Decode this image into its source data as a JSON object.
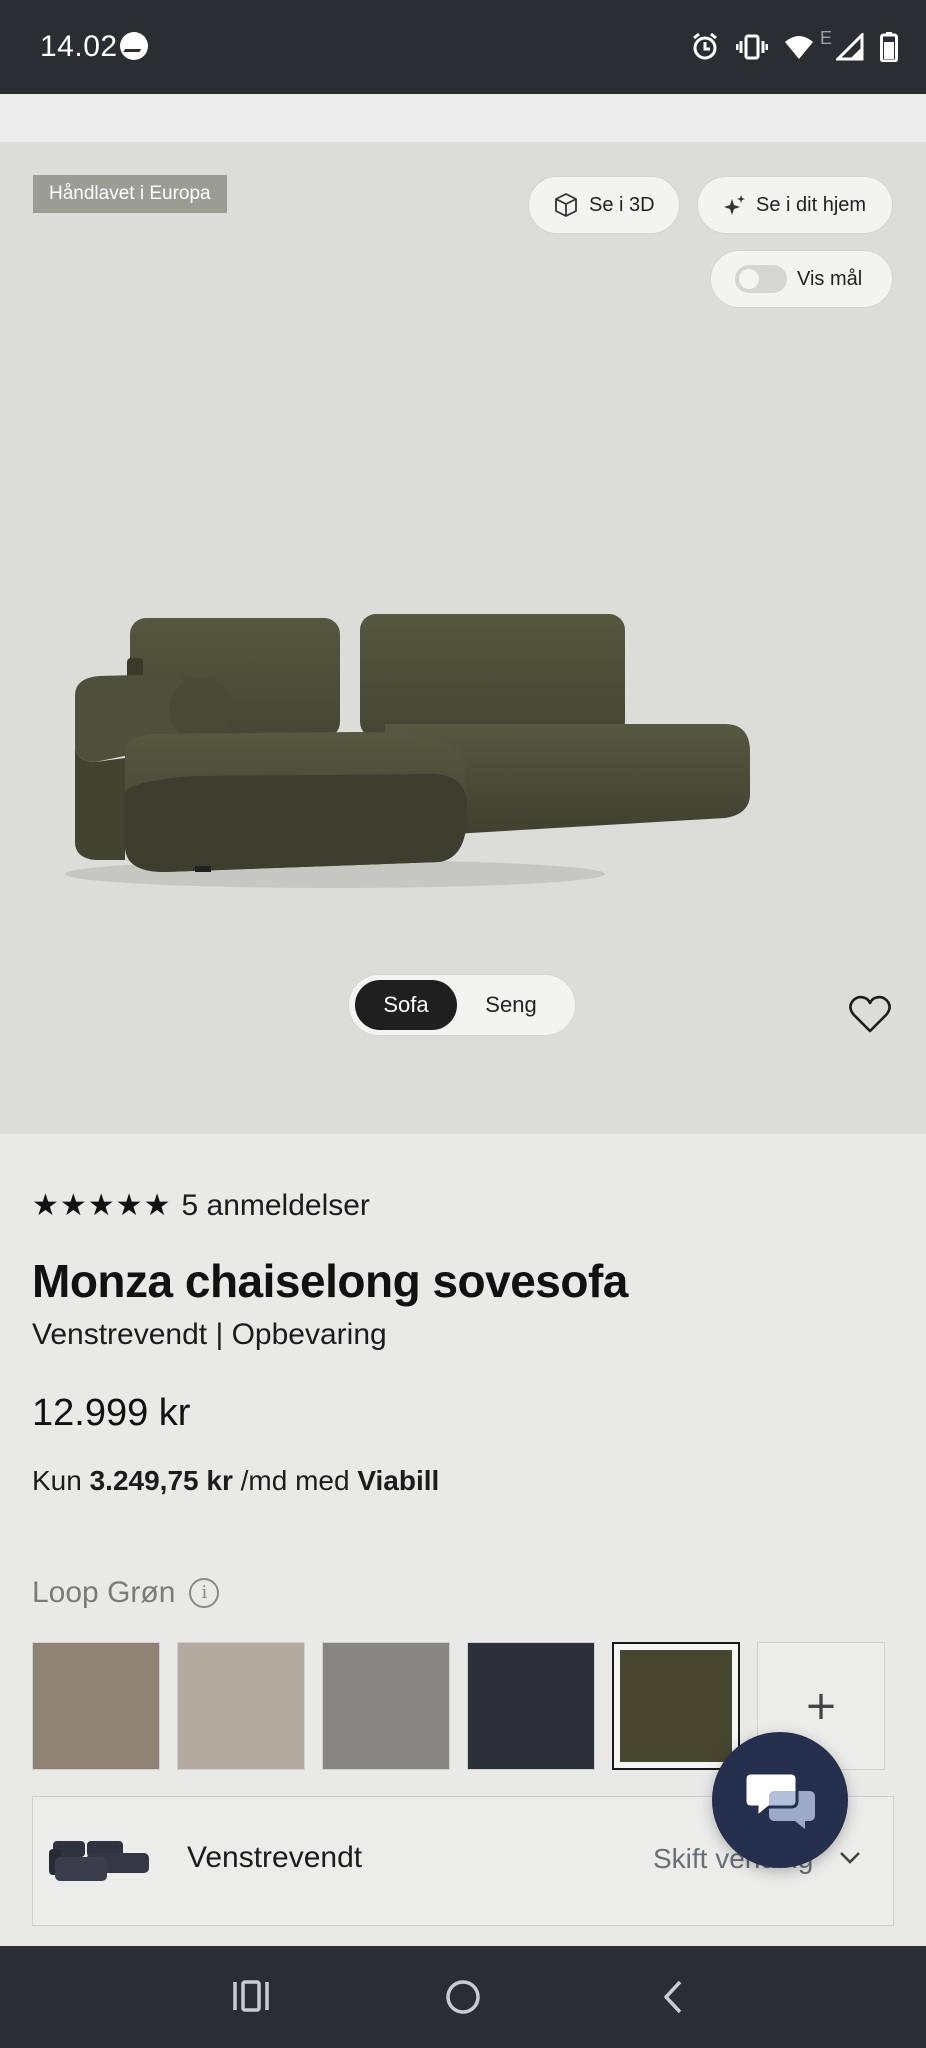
{
  "status_bar": {
    "time": "14.02",
    "network_label": "E"
  },
  "hero": {
    "badge": "Håndlavet i Europa",
    "view_3d": "Se i 3D",
    "view_home": "Se i dit hjem",
    "show_size": "Vis mål",
    "show_size_toggle_on": false,
    "segments": [
      "Sofa",
      "Seng"
    ],
    "active_segment": "Sofa"
  },
  "product": {
    "stars": "★★★★★",
    "rating_value": 5,
    "reviews": "5 anmeldelser",
    "title": "Monza chaiselong sovesofa",
    "subtitle": "Venstrevendt | Opbevaring",
    "price": "12.999 kr",
    "finance": {
      "prefix": "Kun",
      "amount": "3.249,75 kr",
      "middle": "/md med",
      "provider": "Viabill"
    }
  },
  "colors": {
    "selected_name": "Loop Grøn",
    "info_icon": "i",
    "more_label": "+",
    "swatches": [
      {
        "name": "swatch-taupe",
        "color": "#8e8275",
        "selected": false
      },
      {
        "name": "swatch-beige",
        "color": "#b3aba0",
        "selected": false
      },
      {
        "name": "swatch-grey",
        "color": "#878683",
        "selected": false
      },
      {
        "name": "swatch-navy",
        "color": "#2c3038",
        "selected": false
      },
      {
        "name": "swatch-green",
        "color": "#47472f",
        "selected": true
      }
    ]
  },
  "orientation": {
    "label": "Venstrevendt",
    "change": "Skift vending"
  },
  "theme": {
    "sofa_color": "#4a4b36",
    "chat_button": "#24304d",
    "system_bar": "#2a2e33"
  }
}
